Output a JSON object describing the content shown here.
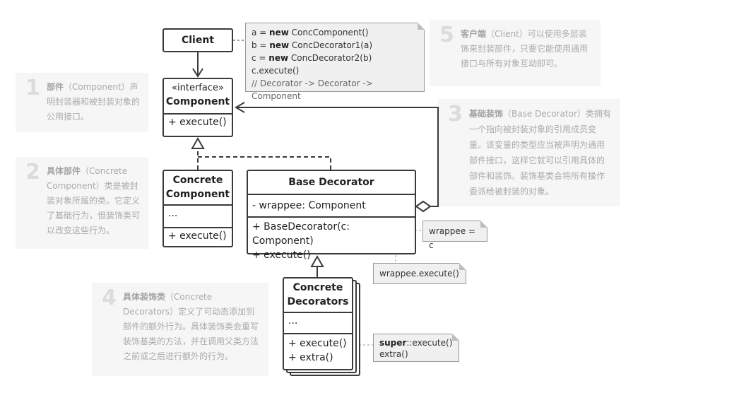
{
  "classes": {
    "client": {
      "name": "Client"
    },
    "component": {
      "stereotype": "«interface»",
      "name": "Component",
      "method": "+ execute()"
    },
    "concrete_component": {
      "name_line1": "Concrete",
      "name_line2": "Component",
      "fields": "...",
      "method": "+ execute()"
    },
    "base_decorator": {
      "name": "Base Decorator",
      "field": "- wrappee: Component",
      "method1": "+ BaseDecorator(c: Component)",
      "method2": "+ execute()"
    },
    "concrete_decorators": {
      "name_line1": "Concrete",
      "name_line2": "Decorators",
      "fields": "...",
      "method1": "+ execute()",
      "method2": "+ extra()"
    }
  },
  "code_note": {
    "line1_prefix": "a = ",
    "line1_kw": "new",
    "line1_rest": " ConcComponent()",
    "line2_prefix": "b = ",
    "line2_kw": "new",
    "line2_rest": " ConcDecorator1(a)",
    "line3_prefix": "c = ",
    "line3_kw": "new",
    "line3_rest": " ConcDecorator2(b)",
    "line4": "c.execute()",
    "line5": "// Decorator -> Decorator -> Component"
  },
  "notes": {
    "wrappee_assign": "wrappee = c",
    "wrappee_execute": "wrappee.execute()",
    "super_kw": "super",
    "super_rest": "::execute()",
    "extra": "extra()"
  },
  "panels": {
    "p1": {
      "num": "1",
      "title": "部件",
      "body": "（Component）声明封装器和被封装对象的公用接口。"
    },
    "p2": {
      "num": "2",
      "title": "具体部件",
      "body": "（Concrete Component）类是被封装对象所属的类。它定义了基础行为，但装饰类可以改变这些行为。"
    },
    "p3": {
      "num": "3",
      "title": "基础装饰",
      "body": "（Base Decorator）类拥有一个指向被封装对象的引用成员变量。该变量的类型应当被声明为通用部件接口，这样它就可以引用具体的部件和装饰。装饰基类会将所有操作委派给被封装的对象。"
    },
    "p4": {
      "num": "4",
      "title": "具体装饰类",
      "body": "（Concrete Decorators）定义了可动态添加到部件的额外行为。具体装饰类会重写装饰基类的方法，并在调用父类方法之前或之后进行额外的行为。"
    },
    "p5": {
      "num": "5",
      "title": "客户端",
      "body": "（Client）可以使用多层装饰来封装部件，只要它能使用通用接口与所有对象互动即可。"
    }
  }
}
